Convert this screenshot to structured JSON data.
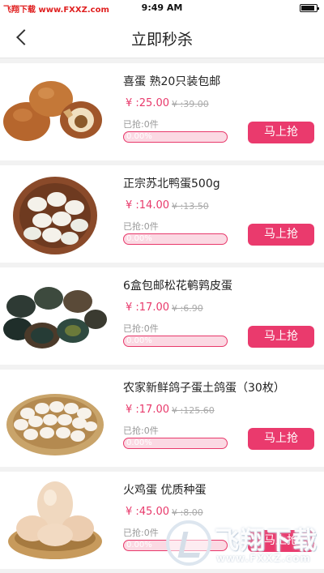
{
  "status_bar": {
    "carrier": "飞翔下载 www.FXXZ.com",
    "time": "9:49 AM"
  },
  "nav": {
    "title": "立即秒杀",
    "back_icon": "chevron-left-icon"
  },
  "products": [
    {
      "name": "喜蛋 熟20只装包邮",
      "price": "¥ :25.00",
      "old_price": "¥ :39.00",
      "sold": "已抢:0件",
      "progress_pct": "0.00%",
      "progress": 0,
      "button": "马上抢"
    },
    {
      "name": "正宗苏北鸭蛋500g",
      "price": "¥ :14.00",
      "old_price": "¥ :13.50",
      "sold": "已抢:0件",
      "progress_pct": "0.00%",
      "progress": 0,
      "button": "马上抢"
    },
    {
      "name": "6盒包邮松花鹌鹑皮蛋",
      "price": "¥ :17.00",
      "old_price": "¥ :6.90",
      "sold": "已抢:0件",
      "progress_pct": "0.00%",
      "progress": 0,
      "button": "马上抢"
    },
    {
      "name": "农家新鲜鸽子蛋土鸽蛋（30枚）",
      "price": "¥ :17.00",
      "old_price": "¥ :125.60",
      "sold": "已抢:0件",
      "progress_pct": "0.00%",
      "progress": 0,
      "button": "马上抢"
    },
    {
      "name": "火鸡蛋 优质种蛋",
      "price": "¥ :45.00",
      "old_price": "¥ :8.00",
      "sold": "已抢:0件",
      "progress_pct": "0.00%",
      "progress": 0,
      "button": "马上抢"
    }
  ],
  "watermark": {
    "text": "飞翔下载",
    "url": "www.FXXZ.com"
  },
  "colors": {
    "accent": "#ea3a6d",
    "price": "#e8396b"
  }
}
